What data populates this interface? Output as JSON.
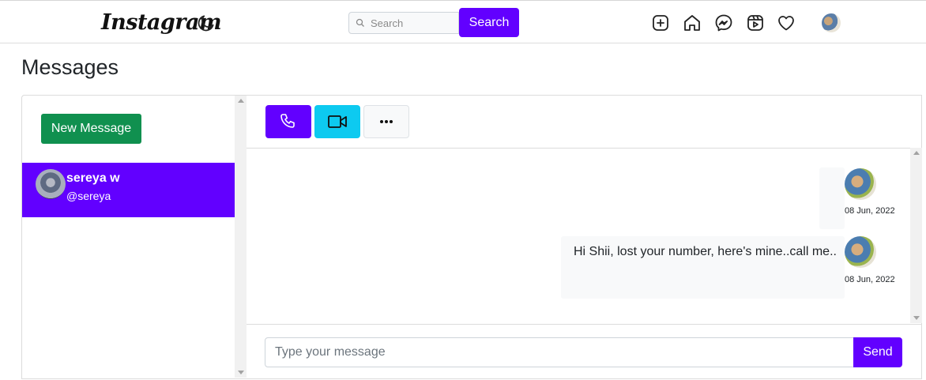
{
  "header": {
    "logo_text": "Instagram",
    "search": {
      "placeholder": "Search",
      "button_label": "Search"
    },
    "icons": [
      "moon-icon",
      "add-post-icon",
      "home-icon",
      "messenger-icon",
      "reels-icon",
      "heart-icon"
    ]
  },
  "page": {
    "title": "Messages"
  },
  "sidebar": {
    "new_message_label": "New Message",
    "contacts": [
      {
        "name": "sereya w",
        "handle": "@sereya"
      }
    ]
  },
  "chat": {
    "toolbar": {
      "icons": [
        "phone-icon",
        "video-icon",
        "more-icon"
      ]
    },
    "messages": [
      {
        "text": "",
        "date": "08 Jun, 2022"
      },
      {
        "text": "Hi Shii, lost your number, here's mine..call me..",
        "date": "08 Jun, 2022"
      }
    ],
    "compose": {
      "placeholder": "Type your message",
      "send_label": "Send"
    }
  },
  "colors": {
    "primary": "#6200ff",
    "success": "#10904f",
    "info": "#0dcaf0",
    "light": "#f8f9fa"
  }
}
